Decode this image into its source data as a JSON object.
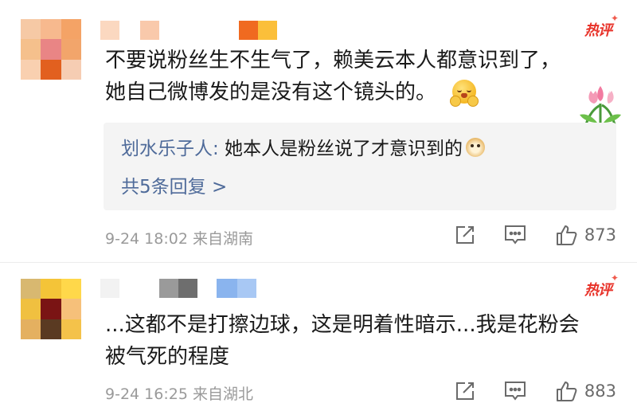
{
  "comments": [
    {
      "hot_label": "热评",
      "text_lines": [
        "不要说粉丝生不生气了，赖美云本人都意识到了，",
        "她自己微博发的是没有这个镜头的。"
      ],
      "reply": {
        "user": "划水乐子人:",
        "text": " 她本人是粉丝说了才意识到的",
        "more": "共5条回复 >"
      },
      "time": "9-24 18:02",
      "location": "来自湖南",
      "likes": "873"
    },
    {
      "hot_label": "热评",
      "text_lines": [
        "...这都不是打擦边球，这是明着性暗示...我是花粉会",
        "被气死的程度"
      ],
      "time": "9-24 16:25",
      "location": "来自湖北",
      "likes": "883"
    }
  ],
  "icons": {
    "share": "share-icon",
    "comment": "comment-icon",
    "like": "thumbs-up-icon"
  },
  "colors": {
    "hot": "#e8332a",
    "reply_user": "#4f6b9a",
    "meta": "#9a9a9a"
  }
}
